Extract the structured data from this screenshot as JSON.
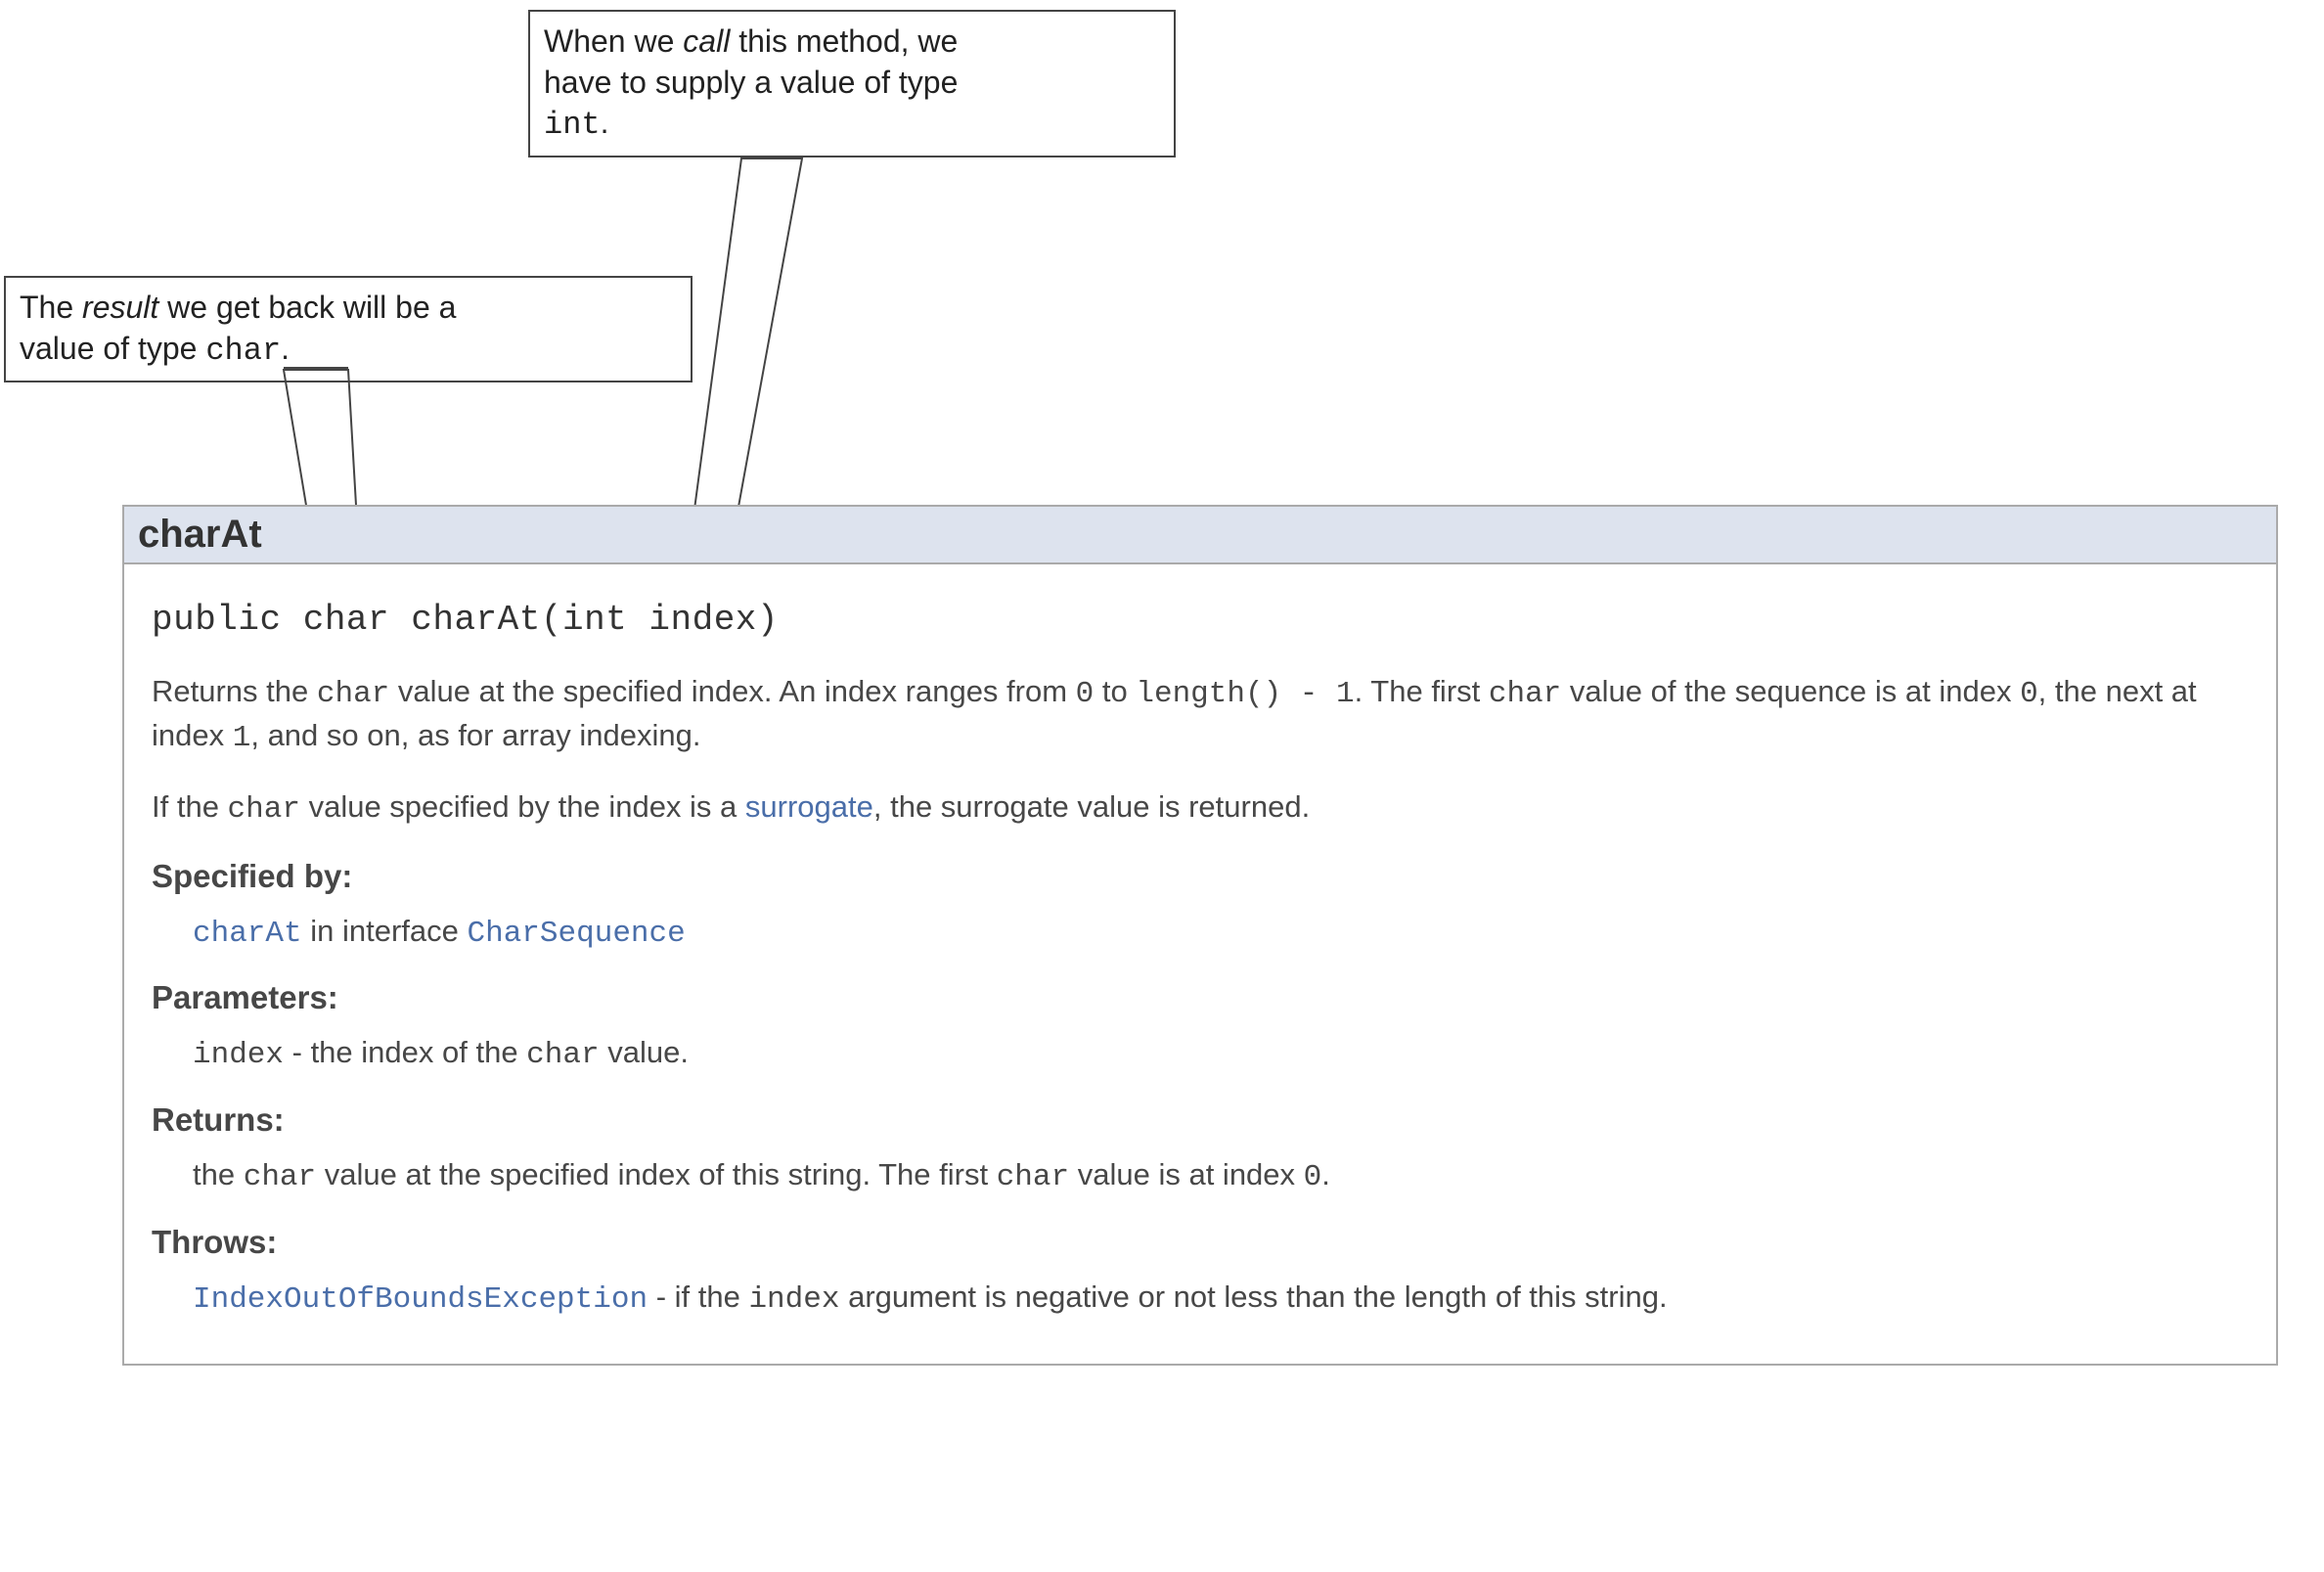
{
  "callouts": {
    "top": {
      "line1": "When we ",
      "em": "call",
      "line1b": " this method, we",
      "line2": "have to supply a value of type",
      "code": "int",
      "after": "."
    },
    "left": {
      "pre": "The ",
      "em": "result",
      "mid": " we get back will be a",
      "line2a": "value of type ",
      "code": "char",
      "after": "."
    }
  },
  "doc": {
    "title": "charAt",
    "signature": "public char charAt(int index)",
    "desc1": {
      "a": "Returns the ",
      "b": "char",
      "c": " value at the specified index. An index ranges from ",
      "d": "0",
      "e": " to ",
      "f": "length() - 1",
      "g": ". The first ",
      "h": "char",
      "i": " value of the sequence is at index ",
      "j": "0",
      "k": ", the next at index ",
      "l": "1",
      "m": ", and so on, as for array indexing."
    },
    "desc2": {
      "a": "If the ",
      "b": "char",
      "c": " value specified by the index is a ",
      "link": "surrogate",
      "d": ", the surrogate value is returned."
    },
    "specified_by_label": "Specified by:",
    "specified_by": {
      "method": "charAt",
      "mid": " in interface ",
      "iface": "CharSequence"
    },
    "parameters_label": "Parameters:",
    "parameters": {
      "name": "index",
      "sep": " - the index of the ",
      "code": "char",
      "tail": " value."
    },
    "returns_label": "Returns:",
    "returns": {
      "a": "the ",
      "b": "char",
      "c": " value at the specified index of this string. The first ",
      "d": "char",
      "e": " value is at index ",
      "f": "0",
      "g": "."
    },
    "throws_label": "Throws:",
    "throws": {
      "ex": "IndexOutOfBoundsException",
      "sep": " - if the ",
      "code": "index",
      "tail": " argument is negative or not less than the length of this string."
    }
  }
}
